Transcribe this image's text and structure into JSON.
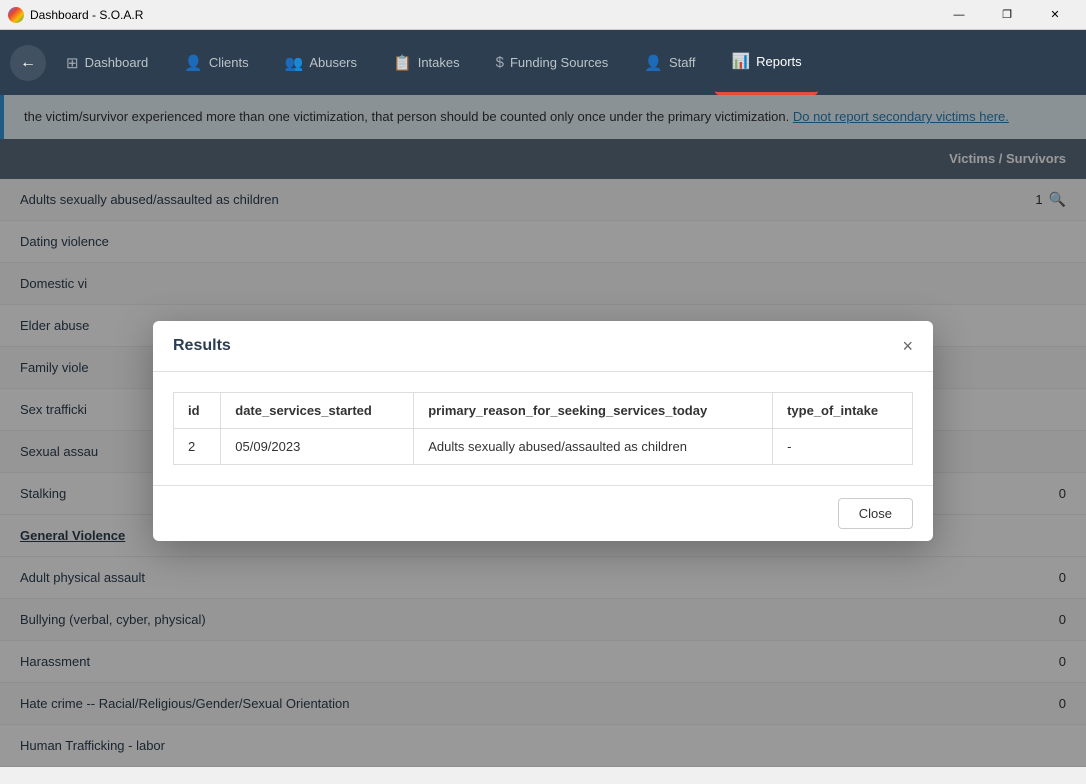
{
  "titleBar": {
    "title": "Dashboard - S.O.A.R",
    "iconAlt": "chrome-icon",
    "minimize": "—",
    "restore": "❐",
    "close": "✕"
  },
  "nav": {
    "backIcon": "←",
    "items": [
      {
        "id": "dashboard",
        "label": "Dashboard",
        "icon": "⊞",
        "active": false
      },
      {
        "id": "clients",
        "label": "Clients",
        "icon": "👤",
        "active": false
      },
      {
        "id": "abusers",
        "label": "Abusers",
        "icon": "👥",
        "active": false
      },
      {
        "id": "intakes",
        "label": "Intakes",
        "icon": "📋",
        "active": false
      },
      {
        "id": "funding-sources",
        "label": "Funding Sources",
        "icon": "$",
        "active": false
      },
      {
        "id": "staff",
        "label": "Staff",
        "icon": "👤",
        "active": false
      },
      {
        "id": "reports",
        "label": "Reports",
        "icon": "📊",
        "active": true
      }
    ]
  },
  "infoBar": {
    "text": "the victim/survivor experienced more than one victimization, that person should be counted only once under the primary victimization.",
    "linkText": "Do not report secondary victims here."
  },
  "tableHeader": {
    "columnLabel": "Victims / Survivors"
  },
  "tableRows": [
    {
      "id": "row-1",
      "label": "Adults sexually abused/assaulted as children",
      "value": "1",
      "hasSearch": true
    },
    {
      "id": "row-2",
      "label": "Dating violence",
      "value": "",
      "hasSearch": false,
      "truncated": true
    },
    {
      "id": "row-3",
      "label": "Domestic vi",
      "value": "",
      "hasSearch": false,
      "truncated": true
    },
    {
      "id": "row-4",
      "label": "Elder abuse",
      "value": "",
      "hasSearch": false,
      "truncated": true
    },
    {
      "id": "row-5",
      "label": "Family viole",
      "value": "",
      "hasSearch": false,
      "truncated": true
    },
    {
      "id": "row-6",
      "label": "Sex trafficki",
      "value": "",
      "hasSearch": false,
      "truncated": true
    },
    {
      "id": "row-7",
      "label": "Sexual assau",
      "value": "",
      "hasSearch": false,
      "truncated": true
    },
    {
      "id": "row-8",
      "label": "Stalking",
      "value": "0",
      "hasSearch": false
    }
  ],
  "sectionHeaders": [
    {
      "id": "general-violence",
      "label": "General Violence"
    }
  ],
  "generalViolenceRows": [
    {
      "id": "row-gv-1",
      "label": "Adult physical assault",
      "value": "0"
    },
    {
      "id": "row-gv-2",
      "label": "Bullying (verbal, cyber, physical)",
      "value": "0"
    },
    {
      "id": "row-gv-3",
      "label": "Harassment",
      "value": "0"
    },
    {
      "id": "row-gv-4",
      "label": "Hate crime -- Racial/Religious/Gender/Sexual Orientation",
      "value": "0"
    },
    {
      "id": "row-gv-5",
      "label": "Human Trafficking - labor",
      "value": ""
    }
  ],
  "modal": {
    "title": "Results",
    "closeIcon": "×",
    "columns": [
      {
        "id": "col-id",
        "label": "id"
      },
      {
        "id": "col-date",
        "label": "date_services_started"
      },
      {
        "id": "col-reason",
        "label": "primary_reason_for_seeking_services_today"
      },
      {
        "id": "col-intake",
        "label": "type_of_intake"
      }
    ],
    "rows": [
      {
        "id": "2",
        "date_services_started": "05/09/2023",
        "primary_reason_for_seeking_services_today": "Adults sexually abused/assaulted as children",
        "type_of_intake": "-"
      }
    ],
    "closeButtonLabel": "Close"
  }
}
